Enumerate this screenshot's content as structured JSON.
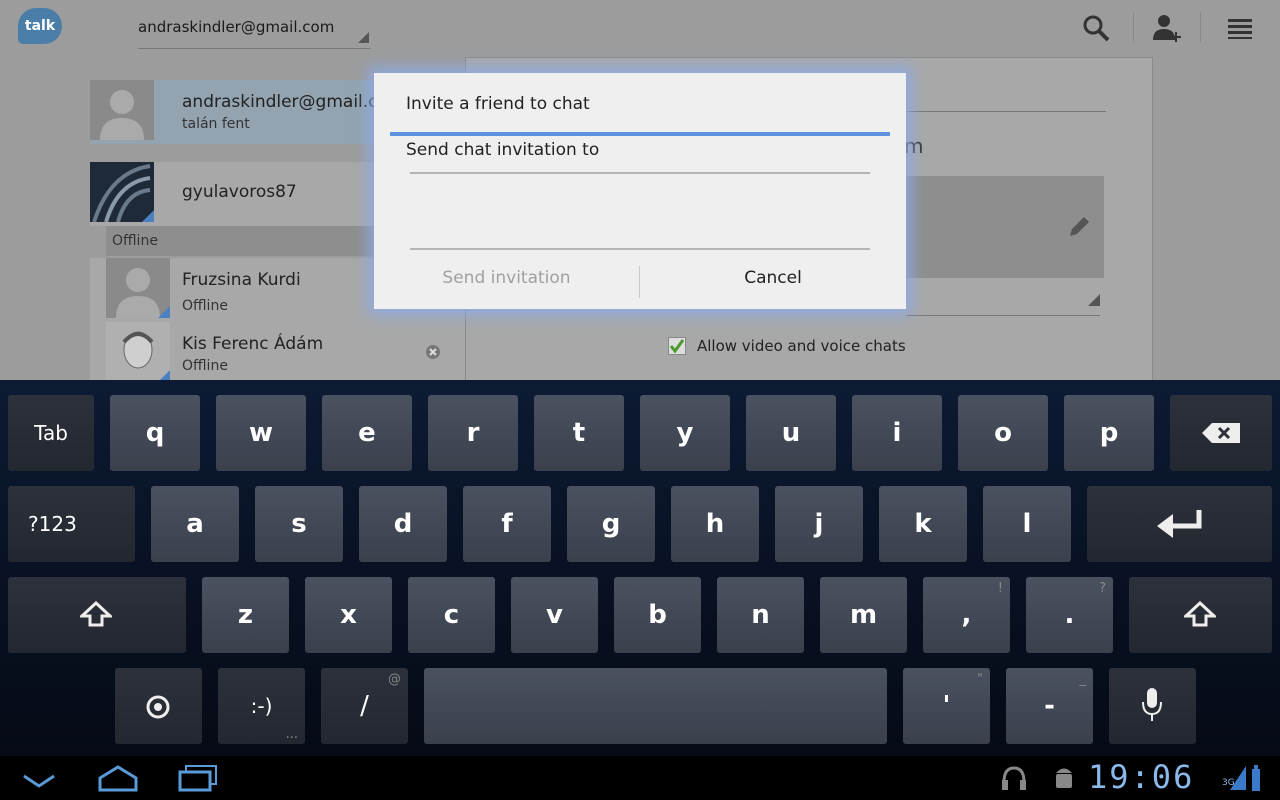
{
  "app": {
    "logo_text": "talk",
    "account_email": "andraskindler@gmail.com"
  },
  "contacts": [
    {
      "name": "andraskindler@gmail.com",
      "status": "talán fent"
    },
    {
      "name": "gyulavoros87",
      "status": ""
    },
    {
      "name": "Fruzsina Kurdi",
      "status": "Offline"
    },
    {
      "name": "Kis Ferenc Ádám",
      "status": "Offline"
    }
  ],
  "section_offline": "Offline",
  "settings": {
    "partial_text": "m",
    "allow_video_label": "Allow video and voice chats",
    "allow_video_checked": true
  },
  "dialog": {
    "title": "Invite a friend to chat",
    "label": "Send chat invitation to",
    "input_value": "",
    "send_button": "Send invitation",
    "cancel_button": "Cancel"
  },
  "keyboard": {
    "row1": [
      "Tab",
      "q",
      "w",
      "e",
      "r",
      "t",
      "y",
      "u",
      "i",
      "o",
      "p"
    ],
    "row2": [
      "?123",
      "a",
      "s",
      "d",
      "f",
      "g",
      "h",
      "j",
      "k",
      "l"
    ],
    "row3": [
      "z",
      "x",
      "c",
      "v",
      "b",
      "n",
      "m",
      ",",
      "."
    ],
    "row3_hints": {
      ",": "!",
      ".": "?"
    },
    "row4": [
      ":-)",
      "/",
      "'",
      "-"
    ],
    "row4_hints": {
      ":-)": "...",
      "/": "@",
      "'": "\"",
      "-": "_"
    }
  },
  "statusbar": {
    "time": "19:06",
    "network": "3G"
  },
  "colors": {
    "accent": "#5b93e0",
    "clock": "#8ab8e8"
  }
}
